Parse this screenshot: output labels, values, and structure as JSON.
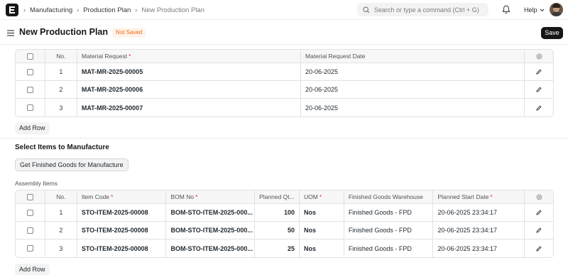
{
  "navbar": {
    "breadcrumbs": [
      "Manufacturing",
      "Production Plan",
      "New Production Plan"
    ],
    "search_placeholder": "Search or type a command (Ctrl + G)",
    "help_label": "Help"
  },
  "header": {
    "title": "New Production Plan",
    "status_badge": "Not Saved",
    "save_label": "Save"
  },
  "material_requests": {
    "columns": [
      "No.",
      "Material Request",
      "Material Request Date"
    ],
    "rows": [
      {
        "no": "1",
        "material_request": "MAT-MR-2025-00005",
        "date": "20-06-2025"
      },
      {
        "no": "2",
        "material_request": "MAT-MR-2025-00006",
        "date": "20-06-2025"
      },
      {
        "no": "3",
        "material_request": "MAT-MR-2025-00007",
        "date": "20-06-2025"
      }
    ],
    "add_row_label": "Add Row"
  },
  "select_items": {
    "section_title": "Select Items to Manufacture",
    "get_button_label": "Get Finished Goods for Manufacture",
    "assembly_label": "Assembly Items",
    "columns": [
      "No.",
      "Item Code",
      "BOM No",
      "Planned Qt...",
      "UOM",
      "Finished Goods Warehouse",
      "Planned Start Date"
    ],
    "rows": [
      {
        "no": "1",
        "item_code": "STO-ITEM-2025-00008",
        "bom_no": "BOM-STO-ITEM-2025-000...",
        "planned_qty": "100",
        "uom": "Nos",
        "warehouse": "Finished Goods - FPD",
        "start_date": "20-06-2025 23:34:17"
      },
      {
        "no": "2",
        "item_code": "STO-ITEM-2025-00008",
        "bom_no": "BOM-STO-ITEM-2025-000...",
        "planned_qty": "50",
        "uom": "Nos",
        "warehouse": "Finished Goods - FPD",
        "start_date": "20-06-2025 23:34:17"
      },
      {
        "no": "3",
        "item_code": "STO-ITEM-2025-00008",
        "bom_no": "BOM-STO-ITEM-2025-000...",
        "planned_qty": "25",
        "uom": "Nos",
        "warehouse": "Finished Goods - FPD",
        "start_date": "20-06-2025 23:34:17"
      }
    ],
    "add_row_label": "Add Row"
  },
  "colors": {
    "primary_dark": "#171717",
    "badge_text": "#e86c13",
    "badge_bg": "#fff4ec",
    "required_marker": "#e03636"
  },
  "icons": [
    "app-logo-icon",
    "chevron-right-icon",
    "search-icon",
    "bell-icon",
    "chevron-down-icon",
    "hamburger-icon",
    "settings-icon",
    "edit-icon"
  ]
}
